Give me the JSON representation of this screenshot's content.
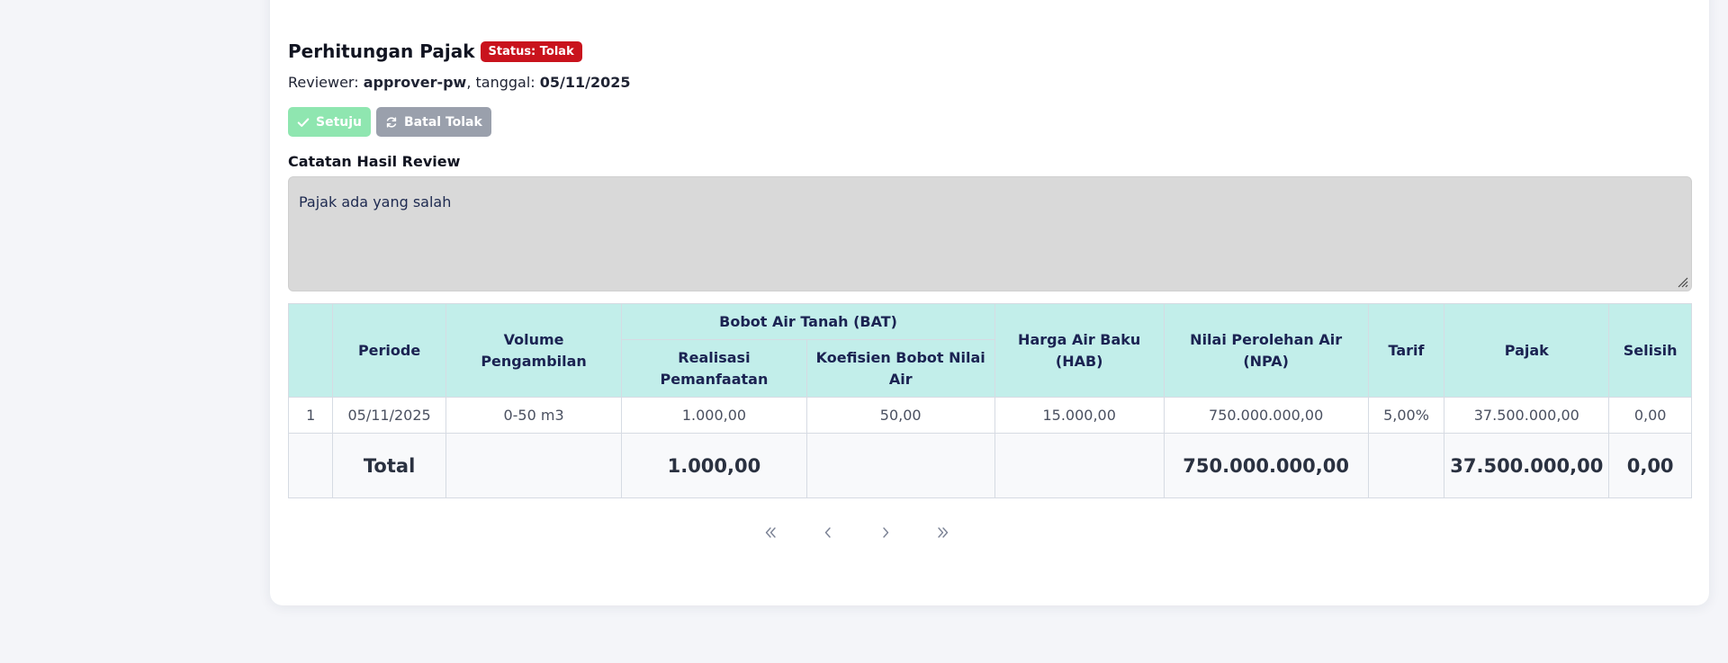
{
  "header": {
    "title": "Perhitungan Pajak",
    "status_badge": "Status: Tolak",
    "reviewer_label": "Reviewer: ",
    "reviewer_name": "approver-pw",
    "date_label": ", tanggal: ",
    "date_value": "05/11/2025"
  },
  "actions": {
    "approve_label": "Setuju",
    "cancel_reject_label": "Batal Tolak"
  },
  "notes": {
    "label": "Catatan Hasil Review",
    "value": "Pajak ada yang salah"
  },
  "table": {
    "headers": {
      "no": "",
      "periode": "Periode",
      "volume": "Volume Pengambilan",
      "bat_group": "Bobot Air Tanah (BAT)",
      "realisasi": "Realisasi Pemanfaatan",
      "koefisien": "Koefisien Bobot Nilai Air",
      "hab": "Harga Air Baku (HAB)",
      "npa": "Nilai Perolehan Air (NPA)",
      "tarif": "Tarif",
      "pajak": "Pajak",
      "selisih": "Selisih"
    },
    "rows": [
      {
        "no": "1",
        "periode": "05/11/2025",
        "volume": "0-50 m3",
        "realisasi": "1.000,00",
        "koefisien": "50,00",
        "hab": "15.000,00",
        "npa": "750.000.000,00",
        "tarif": "5,00%",
        "pajak": "37.500.000,00",
        "selisih": "0,00"
      }
    ],
    "total": {
      "label": "Total",
      "realisasi": "1.000,00",
      "npa": "750.000.000,00",
      "pajak": "37.500.000,00",
      "selisih": "0,00"
    }
  },
  "pagination": {
    "first_icon": "double-chevron-left-icon",
    "prev_icon": "chevron-left-icon",
    "next_icon": "chevron-right-icon",
    "last_icon": "double-chevron-right-icon"
  },
  "colors": {
    "status_reject": "#c9131d",
    "approve_button": "#8fe6b0",
    "cancel_button": "#9aa0ac",
    "table_header": "#c2eeea"
  }
}
